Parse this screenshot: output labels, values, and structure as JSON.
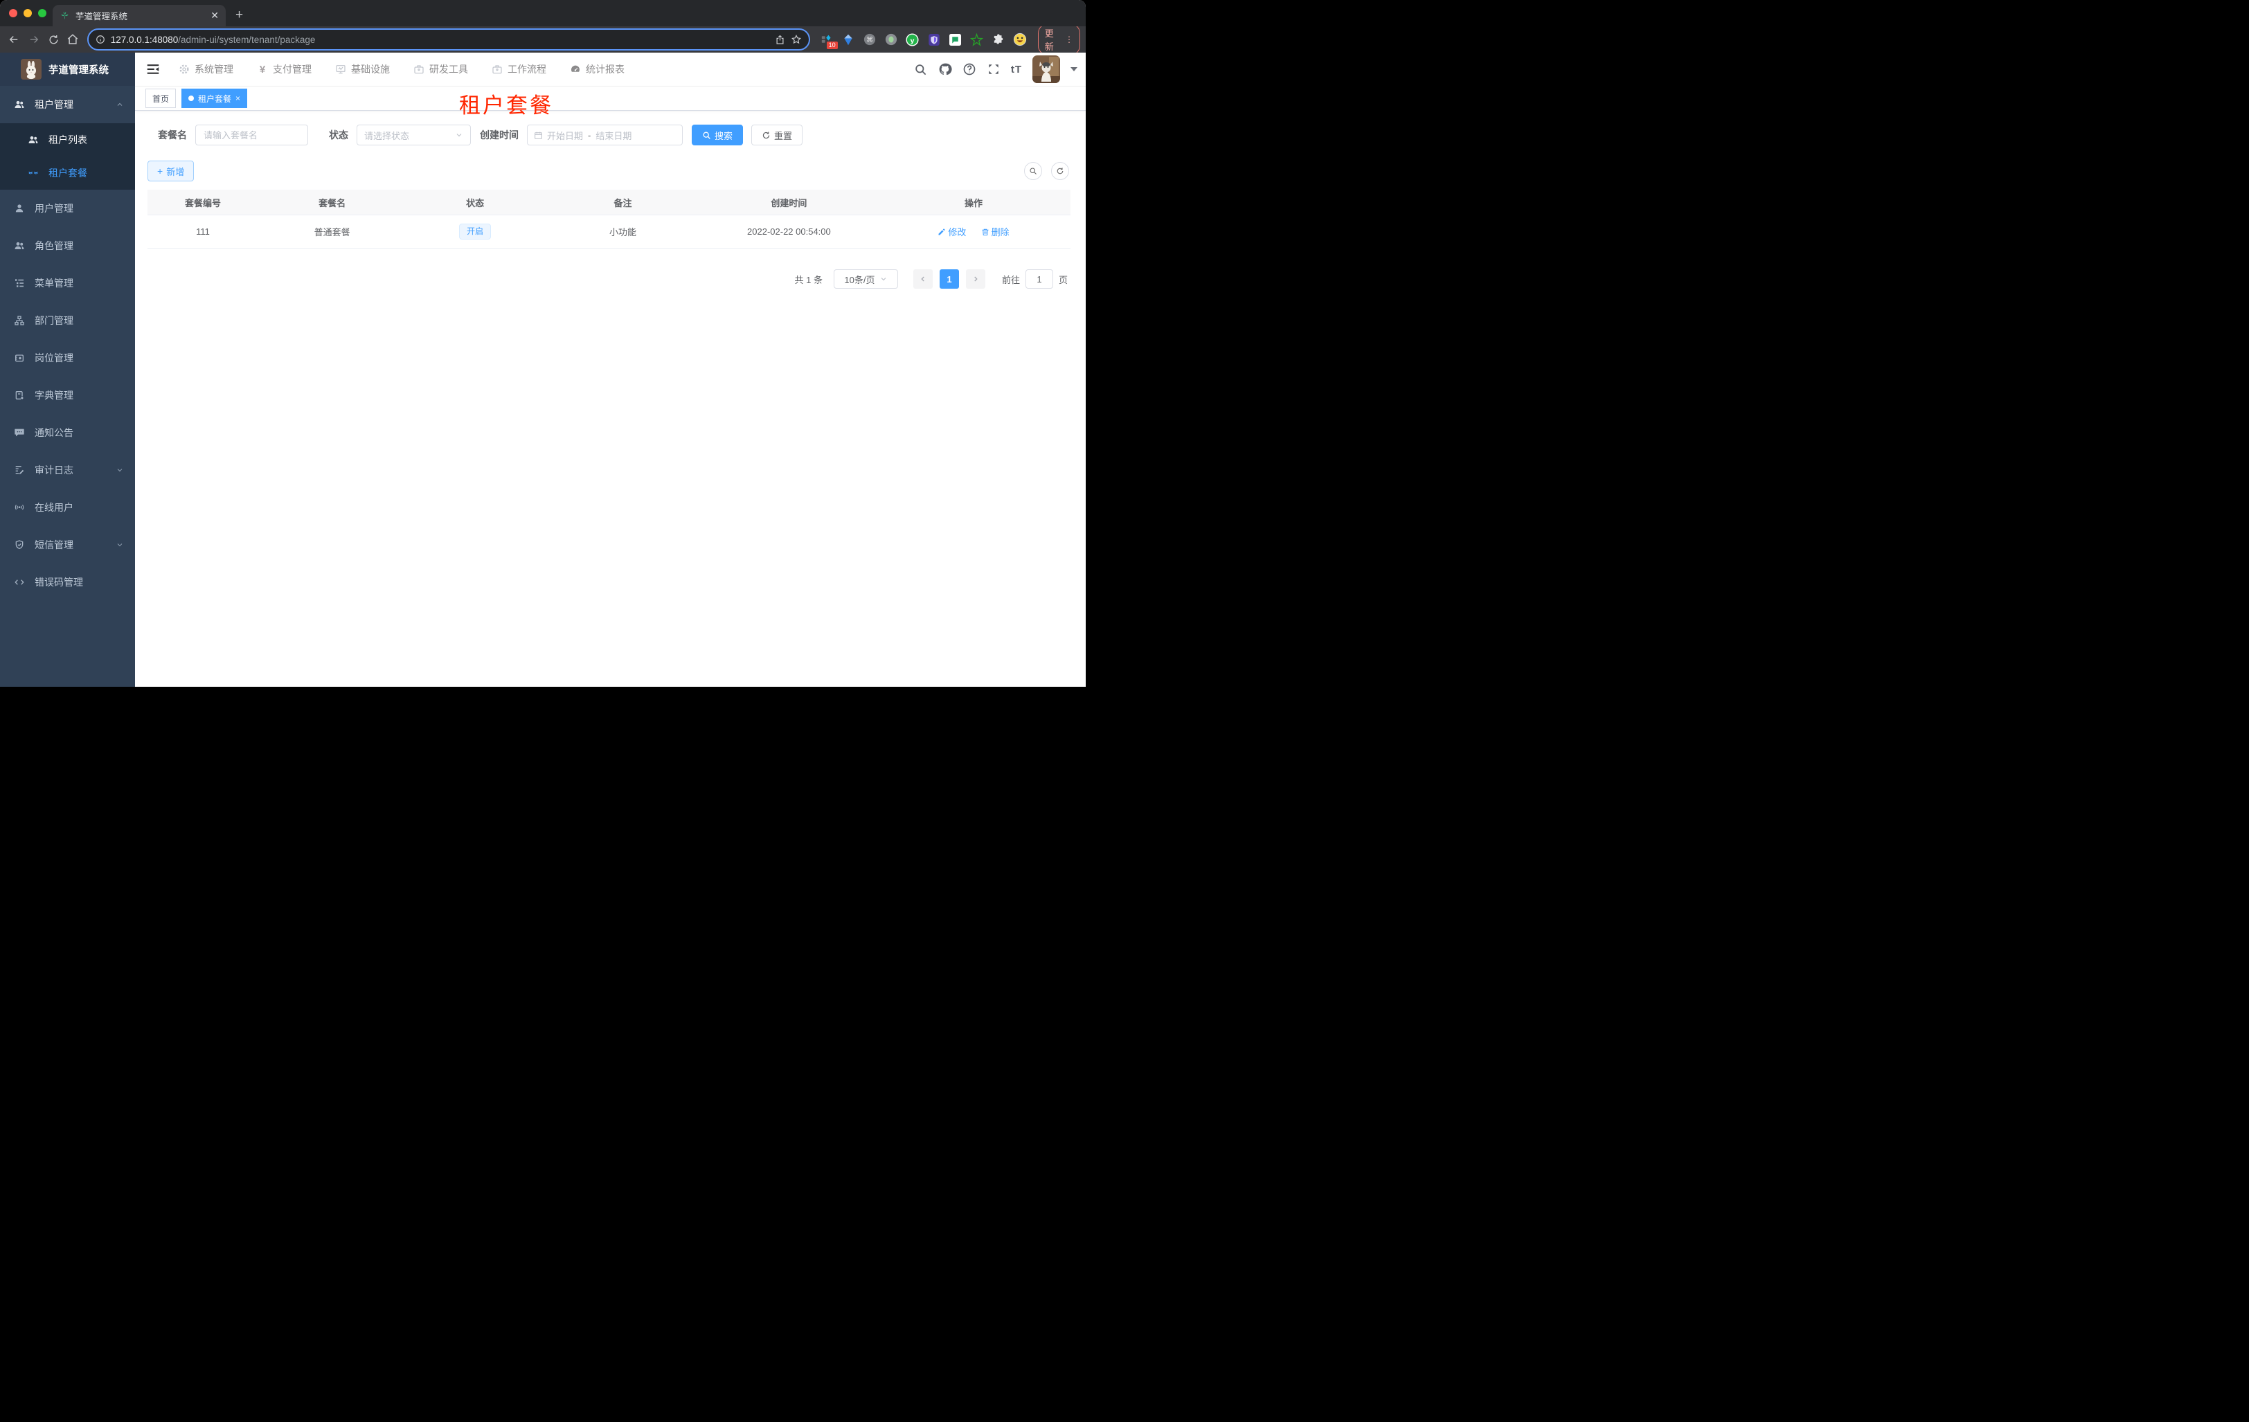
{
  "colors": {
    "accent": "#409eff",
    "page_title_red": "#ff2600",
    "sidebar_bg": "#304156",
    "sidebar_submenu_bg": "#1f2d3d",
    "status_tag_bg": "#ecf5ff"
  },
  "browser": {
    "tab_title": "芋道管理系统",
    "url_host": "127.0.0.1:48080",
    "url_path": "/admin-ui/system/tenant/package",
    "extension_badge": "10",
    "update_label": "更新"
  },
  "sidebar": {
    "logo_title": "芋道管理系统",
    "tenant_group": {
      "label": "租户管理",
      "icon": "users-icon"
    },
    "tenant_children": [
      {
        "label": "租户列表",
        "icon": "users-icon"
      },
      {
        "label": "租户套餐",
        "icon": "package-icon"
      }
    ],
    "items": [
      {
        "label": "用户管理",
        "icon": "user-icon"
      },
      {
        "label": "角色管理",
        "icon": "users-icon"
      },
      {
        "label": "菜单管理",
        "icon": "menu-tree-icon"
      },
      {
        "label": "部门管理",
        "icon": "org-icon"
      },
      {
        "label": "岗位管理",
        "icon": "badge-icon"
      },
      {
        "label": "字典管理",
        "icon": "dict-icon"
      },
      {
        "label": "通知公告",
        "icon": "message-icon"
      },
      {
        "label": "审计日志",
        "icon": "log-icon"
      },
      {
        "label": "在线用户",
        "icon": "online-icon"
      },
      {
        "label": "短信管理",
        "icon": "shield-icon"
      },
      {
        "label": "错误码管理",
        "icon": "code-icon"
      }
    ]
  },
  "topnav": {
    "items": [
      {
        "label": "系统管理",
        "icon": "gear-icon"
      },
      {
        "label": "支付管理",
        "icon": "yen-icon"
      },
      {
        "label": "基础设施",
        "icon": "monitor-icon"
      },
      {
        "label": "研发工具",
        "icon": "briefcase-icon"
      },
      {
        "label": "工作流程",
        "icon": "briefcase-icon"
      },
      {
        "label": "统计报表",
        "icon": "gauge-icon"
      }
    ]
  },
  "tags": {
    "home": "首页",
    "active": "租户套餐"
  },
  "page_title": "租户套餐",
  "search_form": {
    "name_label": "套餐名",
    "name_placeholder": "请输入套餐名",
    "status_label": "状态",
    "status_placeholder": "请选择状态",
    "date_label": "创建时间",
    "date_start_placeholder": "开始日期",
    "date_separator": "-",
    "date_end_placeholder": "结束日期",
    "search_label": "搜索",
    "reset_label": "重置"
  },
  "toolbar": {
    "add_label": "新增"
  },
  "table": {
    "columns": [
      "套餐编号",
      "套餐名",
      "状态",
      "备注",
      "创建时间",
      "操作"
    ],
    "row": {
      "id": "111",
      "name": "普通套餐",
      "status": "开启",
      "remark": "小功能",
      "created": "2022-02-22 00:54:00",
      "edit_label": "修改",
      "delete_label": "删除"
    }
  },
  "pagination": {
    "total": "共 1 条",
    "page_size": "10条/页",
    "current": "1",
    "goto_label": "前往",
    "goto_value": "1",
    "page_unit": "页"
  }
}
